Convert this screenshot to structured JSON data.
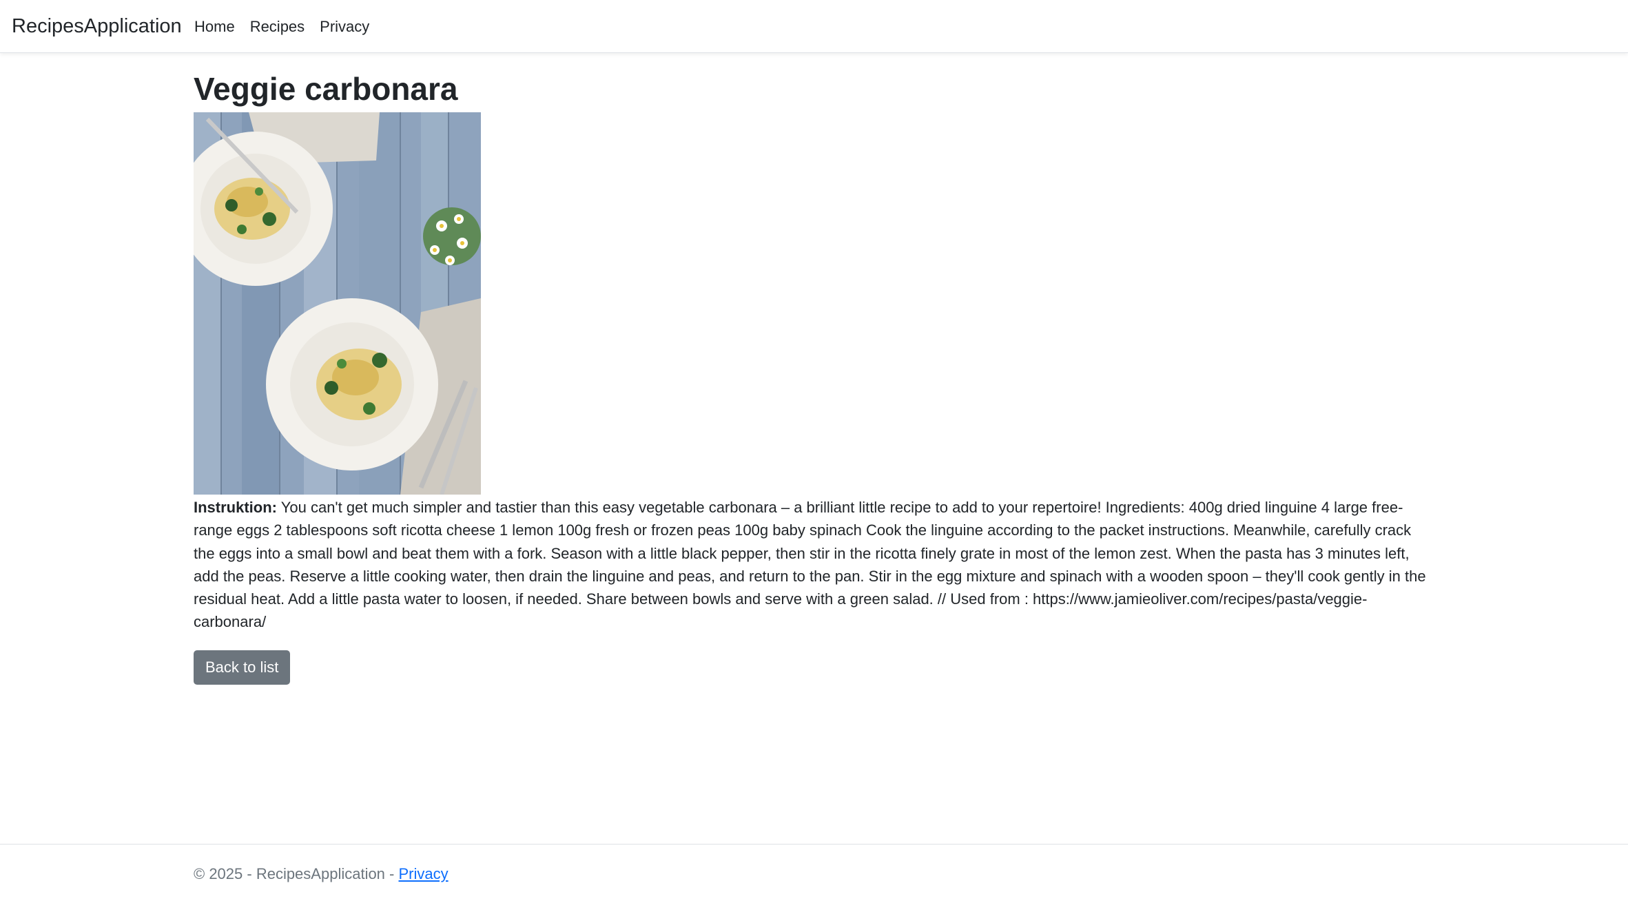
{
  "navbar": {
    "brand": "RecipesApplication",
    "links": [
      {
        "label": "Home"
      },
      {
        "label": "Recipes"
      },
      {
        "label": "Privacy"
      }
    ]
  },
  "recipe": {
    "title": "Veggie carbonara",
    "image_alt": "Veggie carbonara",
    "instructions_label": "Instruktion:",
    "instructions_text": " You can't get much simpler and tastier than this easy vegetable carbonara – a brilliant little recipe to add to your repertoire! Ingredients: 400g dried linguine 4 large free-range eggs 2 tablespoons soft ricotta cheese 1 lemon 100g fresh or frozen peas 100g baby spinach Cook the linguine according to the packet instructions. Meanwhile, carefully crack the eggs into a small bowl and beat them with a fork. Season with a little black pepper, then stir in the ricotta finely grate in most of the lemon zest. When the pasta has 3 minutes left, add the peas. Reserve a little cooking water, then drain the linguine and peas, and return to the pan. Stir in the egg mixture and spinach with a wooden spoon – they'll cook gently in the residual heat. Add a little pasta water to loosen, if needed. Share between bowls and serve with a green salad. // Used from : https://www.jamieoliver.com/recipes/pasta/veggie-carbonara/",
    "back_button": "Back to list"
  },
  "footer": {
    "copyright": "© 2025 - RecipesApplication - ",
    "privacy_link": "Privacy"
  },
  "colors": {
    "button_bg": "#6c757d",
    "link": "#0d6efd",
    "text": "#212529",
    "muted": "#6c757d"
  }
}
